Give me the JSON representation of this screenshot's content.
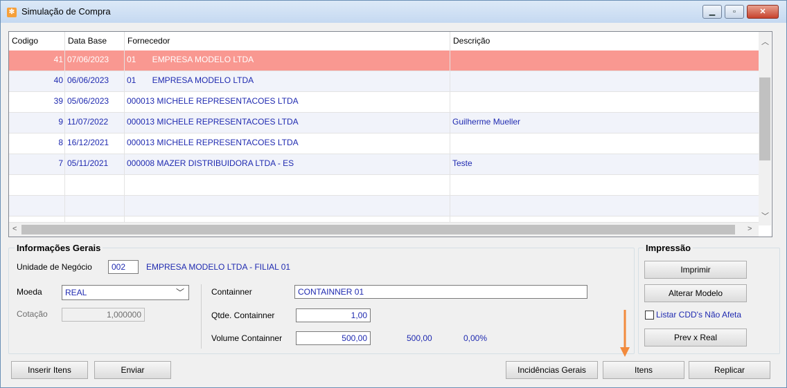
{
  "window": {
    "title": "Simulação de Compra",
    "controls": [
      "minimize",
      "maximize",
      "close"
    ]
  },
  "grid": {
    "columns": [
      "Codigo",
      "Data Base",
      "Fornecedor",
      "Descrição"
    ],
    "rows": [
      {
        "codigo": "41",
        "data": "07/06/2023",
        "fornecedor": "01       EMPRESA MODELO LTDA",
        "descricao": ""
      },
      {
        "codigo": "40",
        "data": "06/06/2023",
        "fornecedor": "01       EMPRESA MODELO LTDA",
        "descricao": ""
      },
      {
        "codigo": "39",
        "data": "05/06/2023",
        "fornecedor": "000013 MICHELE REPRESENTACOES LTDA",
        "descricao": ""
      },
      {
        "codigo": "9",
        "data": "11/07/2022",
        "fornecedor": "000013 MICHELE REPRESENTACOES LTDA",
        "descricao": "Guilherme Mueller"
      },
      {
        "codigo": "8",
        "data": "16/12/2021",
        "fornecedor": "000013 MICHELE REPRESENTACOES LTDA",
        "descricao": ""
      },
      {
        "codigo": "7",
        "data": "05/11/2021",
        "fornecedor": "000008 MAZER DISTRIBUIDORA LTDA - ES",
        "descricao": "Teste"
      }
    ],
    "selected_row": 0
  },
  "info": {
    "title": "Informações Gerais",
    "unidade_label": "Unidade de Negócio",
    "unidade_code": "002",
    "unidade_name": "EMPRESA MODELO LTDA - FILIAL 01",
    "moeda_label": "Moeda",
    "moeda_value": "REAL",
    "cotacao_label": "Cotação",
    "cotacao_value": "1,000000",
    "containner_label": "Containner",
    "containner_value": "CONTAINNER 01",
    "qtde_label": "Qtde. Containner",
    "qtde_value": "1,00",
    "volume_label": "Volume Containner",
    "volume_value": "500,00",
    "volume_total": "500,00",
    "volume_pct": "0,00%"
  },
  "impressao": {
    "title": "Impressão",
    "imprimir": "Imprimir",
    "alterar_modelo": "Alterar Modelo",
    "listar_cdd": "Listar CDD's Não Afeta",
    "prev_real": "Prev x Real"
  },
  "footer": {
    "inserir_itens": "Inserir Itens",
    "enviar": "Enviar",
    "incidencias": "Incidências Gerais",
    "itens": "Itens",
    "replicar": "Replicar"
  },
  "colors": {
    "selected_row": "#f99891",
    "link_text": "#1f2ab0",
    "arrow": "#f28a3c"
  }
}
